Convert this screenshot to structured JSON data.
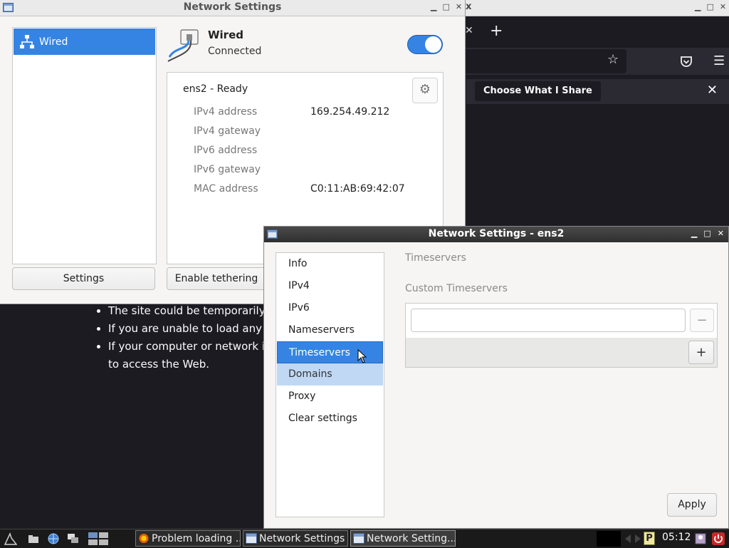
{
  "firefox": {
    "title_fragment": "x",
    "notification_button": "Choose What I Share",
    "content_lines": [
      "The site could be temporarily",
      "If you are unable to load any",
      "If your computer or network i",
      "to access the Web."
    ]
  },
  "network_settings": {
    "window_title": "Network Settings",
    "sidebar_items": [
      {
        "label": "Wired",
        "icon": "network-wired-icon"
      }
    ],
    "device": {
      "title": "Wired",
      "status": "Connected",
      "toggle_on": true
    },
    "connection": {
      "title": "ens2 - Ready",
      "rows": [
        {
          "label": "IPv4 address",
          "value": "169.254.49.212"
        },
        {
          "label": "IPv4 gateway",
          "value": ""
        },
        {
          "label": "IPv6 address",
          "value": ""
        },
        {
          "label": "IPv6 gateway",
          "value": ""
        },
        {
          "label": "MAC address",
          "value": "C0:11:AB:69:42:07"
        }
      ]
    },
    "buttons": {
      "settings": "Settings",
      "tethering": "Enable tethering"
    }
  },
  "dialog": {
    "title": "Network Settings - ens2",
    "nav": [
      "Info",
      "IPv4",
      "IPv6",
      "Nameservers",
      "Timeservers",
      "Domains",
      "Proxy",
      "Clear settings"
    ],
    "selected": "Timeservers",
    "hovered": "Domains",
    "section_title": "Timeservers",
    "custom_label": "Custom Timeservers",
    "timeserver_value": "",
    "remove_symbol": "−",
    "add_symbol": "+",
    "apply": "Apply"
  },
  "taskbar": {
    "tasks": [
      {
        "label": "Problem loading ...",
        "icon": "firefox-icon"
      },
      {
        "label": "Network Settings",
        "icon": "window-icon"
      },
      {
        "label": "Network Setting...",
        "icon": "window-icon"
      }
    ],
    "clock": "05:12",
    "tray_letter": "P"
  },
  "colors": {
    "accent": "#3584e4",
    "firefox_bg": "#1c1b22",
    "dialog_titlebar": "#2f2f2f"
  }
}
